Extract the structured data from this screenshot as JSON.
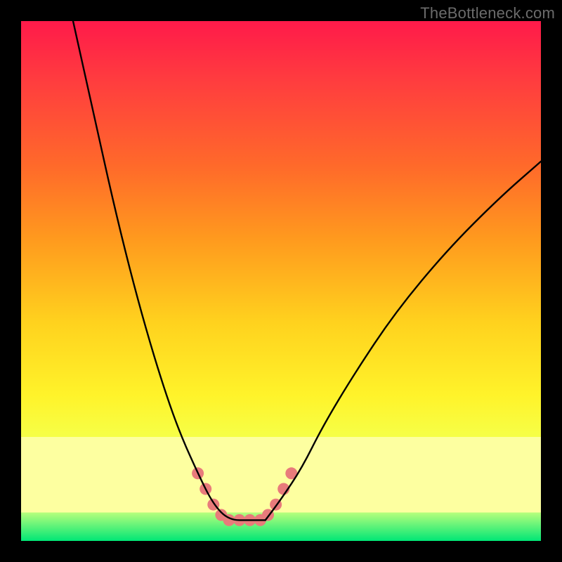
{
  "watermark": "TheBottleneck.com",
  "colors": {
    "background": "#000000",
    "curve": "#000000",
    "marker": "#e87b7b",
    "gradient_top": "#ff1a4a",
    "gradient_mid": "#fff32a",
    "gradient_bottom": "#00e676"
  },
  "chart_data": {
    "type": "line",
    "title": "",
    "xlabel": "",
    "ylabel": "",
    "xlim": [
      0,
      100
    ],
    "ylim": [
      0,
      100
    ],
    "grid": false,
    "note": "Values are read in percent of plot area; (0,0)=top-left, y increases downward as drawn. Two curves descend to a flat minimum around x≈37–47 at y≈96, with pink markers near the trough.",
    "series": [
      {
        "name": "left-curve",
        "x": [
          10,
          14,
          18,
          22,
          26,
          30,
          34,
          37,
          40,
          44,
          47
        ],
        "y": [
          0,
          18,
          36,
          52,
          66,
          78,
          87,
          93,
          96,
          96,
          96
        ]
      },
      {
        "name": "right-curve",
        "x": [
          47,
          50,
          54,
          58,
          64,
          72,
          82,
          92,
          100
        ],
        "y": [
          96,
          92,
          86,
          78,
          68,
          56,
          44,
          34,
          27
        ]
      }
    ],
    "markers": {
      "name": "trough-markers",
      "color": "#e87b7b",
      "points": [
        {
          "x": 34,
          "y": 87
        },
        {
          "x": 35.5,
          "y": 90
        },
        {
          "x": 37,
          "y": 93
        },
        {
          "x": 38.5,
          "y": 95
        },
        {
          "x": 40,
          "y": 96
        },
        {
          "x": 42,
          "y": 96
        },
        {
          "x": 44,
          "y": 96
        },
        {
          "x": 46,
          "y": 96
        },
        {
          "x": 47.5,
          "y": 95
        },
        {
          "x": 49,
          "y": 93
        },
        {
          "x": 50.5,
          "y": 90
        },
        {
          "x": 52,
          "y": 87
        }
      ]
    }
  }
}
